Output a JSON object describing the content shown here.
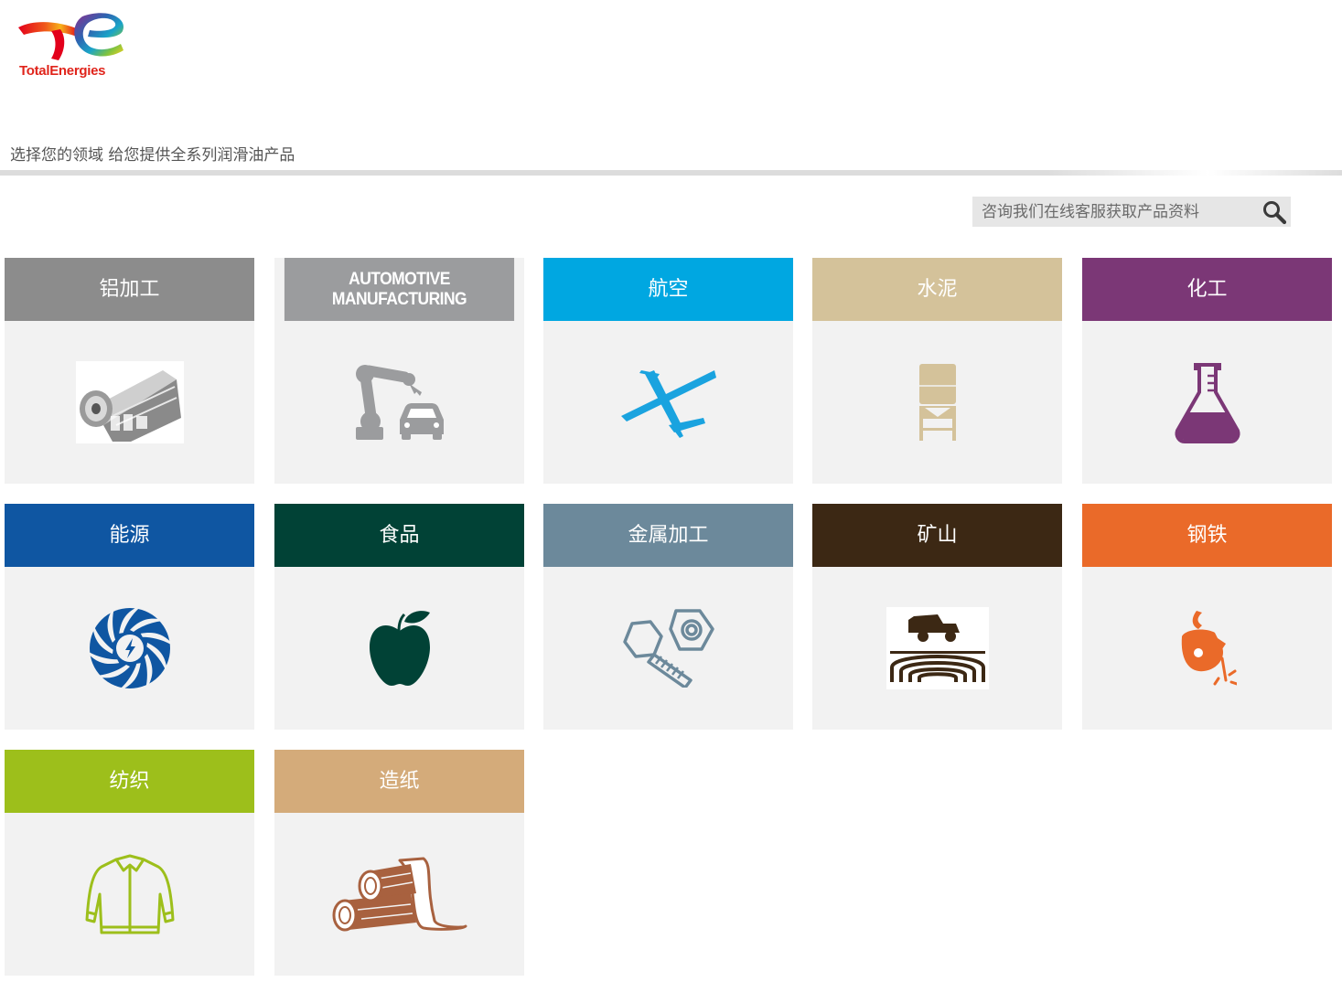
{
  "brand": {
    "name": "TotalEnergies",
    "color": "#e0241b"
  },
  "tagline": "选择您的领域 给您提供全系列润滑油产品",
  "search": {
    "placeholder": "咨询我们在线客服获取产品资料",
    "icon": "search-icon"
  },
  "sectors": [
    {
      "label": "铝加工",
      "color": "#8c8c8c",
      "icon": "aluminium-roll-icon"
    },
    {
      "label": "AUTOMOTIVE\nMANUFACTURING",
      "color": "#9b9c9e",
      "icon": "robot-arm-car-icon"
    },
    {
      "label": "航空",
      "color": "#00a7e1",
      "icon": "airplane-icon"
    },
    {
      "label": "水泥",
      "color": "#d4c29a",
      "icon": "cement-silo-icon"
    },
    {
      "label": "化工",
      "color": "#7b3776",
      "icon": "flask-icon"
    },
    {
      "label": "能源",
      "color": "#0f56a2",
      "icon": "turbine-icon"
    },
    {
      "label": "食品",
      "color": "#014236",
      "icon": "apple-icon"
    },
    {
      "label": "金属加工",
      "color": "#6c899b",
      "icon": "bolt-nut-icon"
    },
    {
      "label": "矿山",
      "color": "#3c2814",
      "icon": "mining-truck-icon"
    },
    {
      "label": "钢铁",
      "color": "#ea6a29",
      "icon": "ladle-icon"
    },
    {
      "label": "纺织",
      "color": "#9dbf1b",
      "icon": "jacket-icon"
    },
    {
      "label": "造纸",
      "color": "#d4ab7a",
      "icon": "logs-paper-icon"
    }
  ]
}
